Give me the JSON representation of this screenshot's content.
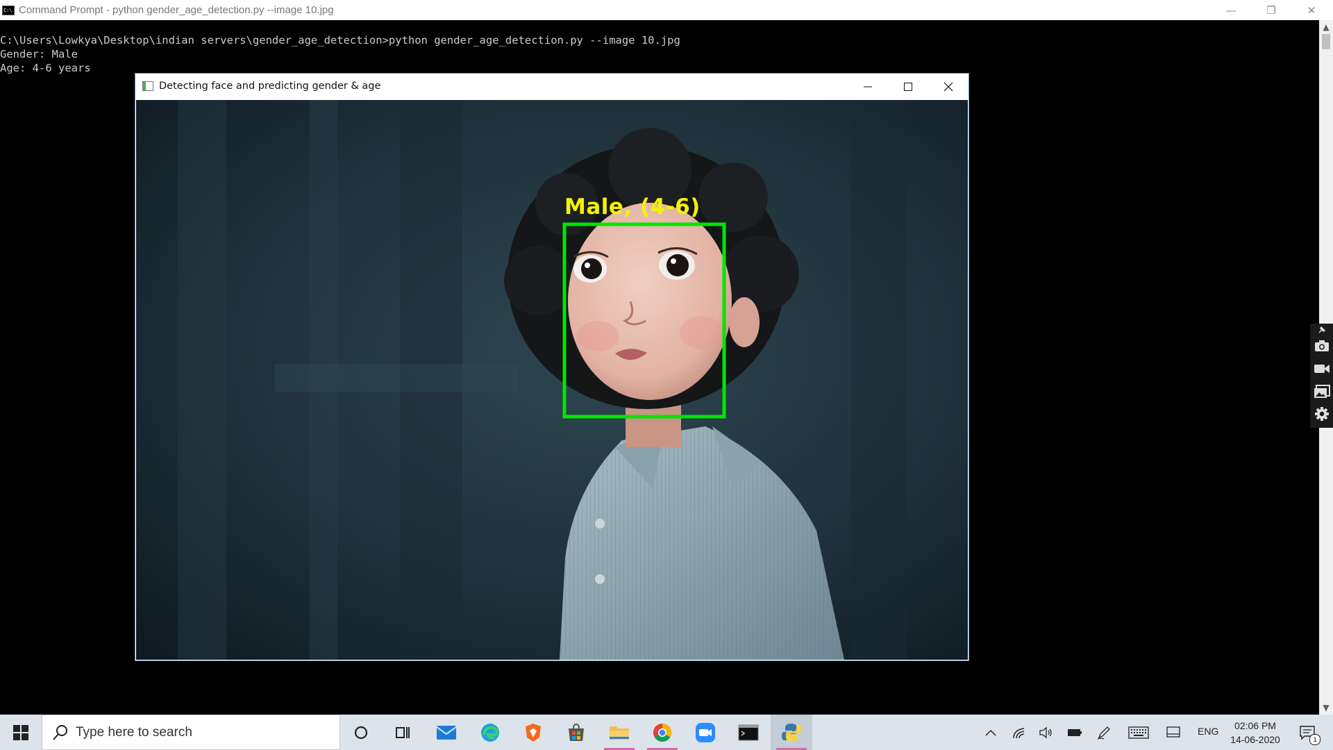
{
  "cmd_window": {
    "title": "Command Prompt - python  gender_age_detection.py --image 10.jpg",
    "icon_text": "C:\\",
    "controls": {
      "minimize": "—",
      "restore": "❐",
      "close": "✕"
    }
  },
  "console": {
    "lines": [
      "C:\\Users\\Lowkya\\Desktop\\indian servers\\gender_age_detection>python gender_age_detection.py --image 10.jpg",
      "Gender: Male",
      "Age: 4-6 years"
    ]
  },
  "image_window": {
    "title": "Detecting face and predicting gender & age",
    "face_label": "Male, (4-6)",
    "box_color": "#00e600",
    "label_color": "#f5f200"
  },
  "side_toolbar": {
    "icons": [
      "pin-icon",
      "camera-icon",
      "video-icon",
      "gallery-icon",
      "settings-icon"
    ]
  },
  "taskbar": {
    "search_placeholder": "Type here to search",
    "apps": [
      "cortana-icon",
      "task-view-icon",
      "mail-icon",
      "edge-icon",
      "brave-icon",
      "store-icon",
      "file-explorer-icon",
      "chrome-icon",
      "zoom-icon",
      "terminal-icon",
      "python-icon"
    ],
    "tray": {
      "language": "ENG",
      "time": "02:06 PM",
      "date": "14-06-2020",
      "notification_count": "1"
    }
  },
  "colors": {
    "taskbar_bg": "#dde3ea",
    "console_text": "#cccccc",
    "active_app_underline": "#d36ba8"
  }
}
